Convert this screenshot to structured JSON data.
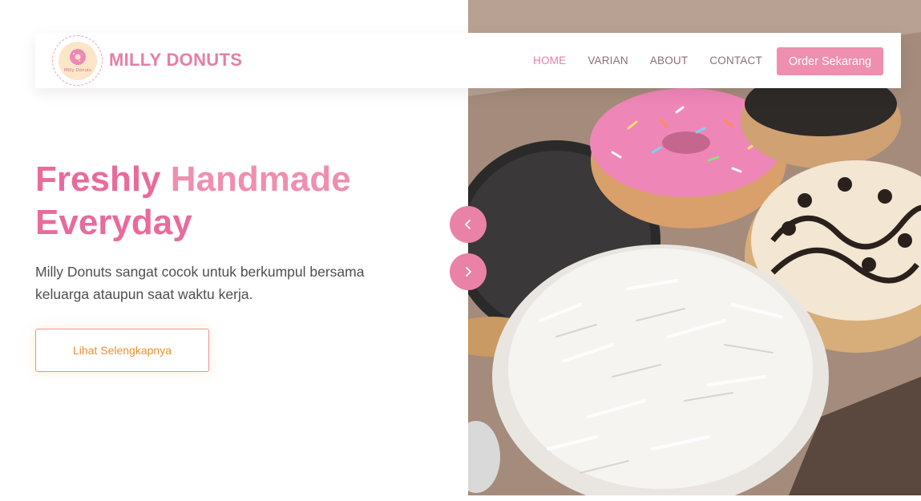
{
  "brand": {
    "name": "MILLY DONUTS",
    "logo_text": "Milly Donuts",
    "color": "#e67ea5"
  },
  "nav": {
    "items": [
      {
        "label": "HOME",
        "active": true
      },
      {
        "label": "VARIAN",
        "active": false
      },
      {
        "label": "ABOUT",
        "active": false
      },
      {
        "label": "CONTACT",
        "active": false
      }
    ],
    "cta_label": "Order Sekarang"
  },
  "hero": {
    "title_word_1": "Freshly",
    "title_word_2": "Handmade",
    "title_word_3": "Everyday",
    "description": "Milly Donuts sangat cocok untuk berkumpul bersama keluarga ataupun saat waktu kerja.",
    "button_label": "Lihat Selengkapnya",
    "image": "donut-box-photo"
  },
  "slider": {
    "prev_icon": "chevron-left-icon",
    "next_icon": "chevron-right-icon"
  },
  "colors": {
    "accent": "#ef8fb0",
    "title_pink": "#e86b9c",
    "cta_text": "#e8922e",
    "nav_text": "#8a6f78"
  }
}
